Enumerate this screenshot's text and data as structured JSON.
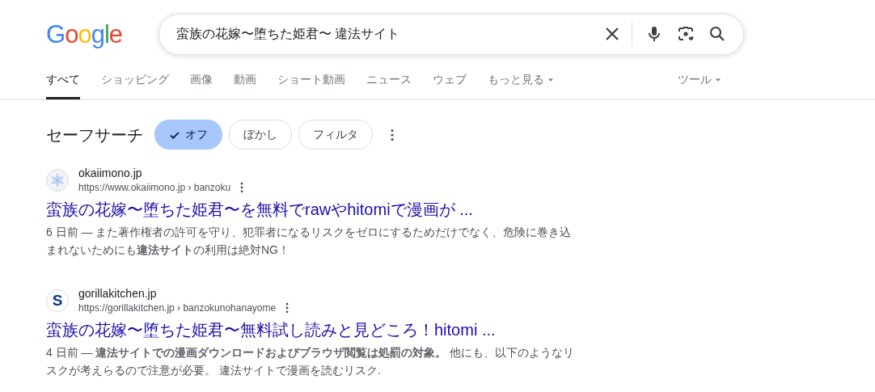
{
  "logo": "Google",
  "search": {
    "value": "蛮族の花嫁〜堕ちた姫君〜 違法サイト"
  },
  "tabs": [
    {
      "label": "すべて",
      "selected": true
    },
    {
      "label": "ショッピング",
      "selected": false
    },
    {
      "label": "画像",
      "selected": false
    },
    {
      "label": "動画",
      "selected": false
    },
    {
      "label": "ショート動画",
      "selected": false
    },
    {
      "label": "ニュース",
      "selected": false
    },
    {
      "label": "ウェブ",
      "selected": false
    },
    {
      "label": "もっと見る",
      "selected": false,
      "dropdown": true
    }
  ],
  "tools": "ツール",
  "safesearch": {
    "label": "セーフサーチ",
    "options": [
      {
        "label": "オフ",
        "selected": true
      },
      {
        "label": "ぼかし",
        "selected": false
      },
      {
        "label": "フィルタ",
        "selected": false
      }
    ]
  },
  "results": [
    {
      "favicon": {
        "kind": "snowflake"
      },
      "site": "okaiimono.jp",
      "url": "https://www.okaiimono.jp › banzoku",
      "title": "蛮族の花嫁〜堕ちた姫君〜を無料でrawやhitomiで漫画が ...",
      "snippet": "6 日前 — また著作権者の許可を守り、犯罪者になるリスクをゼロにするためだけでなく、危険に巻き込まれないためにも**違法サイト**の利用は絶対NG！"
    },
    {
      "favicon": {
        "kind": "letter",
        "text": "S"
      },
      "site": "gorillakitchen.jp",
      "url": "https://gorillakitchen.jp › banzokunohanayome",
      "title": "蛮族の花嫁〜堕ちた姫君〜無料試し読みと見どころ！hitomi ...",
      "snippet": "4 日前 — **違法サイトでの漫画ダウンロードおよびブラウザ閲覧は処罰の対象。** 他にも、以下のようなリスクが考えらるので注意が必要。 違法サイトで漫画を読むリスク."
    }
  ]
}
